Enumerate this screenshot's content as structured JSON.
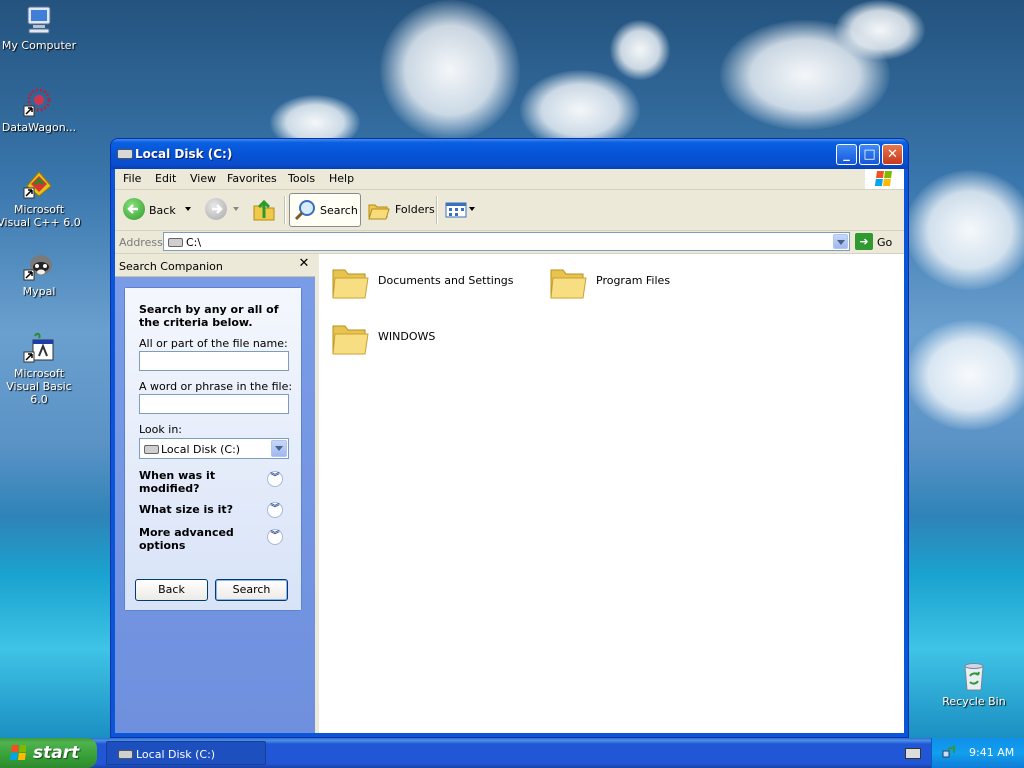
{
  "desktop": {
    "icons": [
      {
        "label": "My Computer"
      },
      {
        "label": "DataWagon..."
      },
      {
        "label": "Microsoft Visual C++ 6.0"
      },
      {
        "label": "Mypal"
      },
      {
        "label": "Microsoft Visual Basic 6.0"
      },
      {
        "label": "Recycle Bin"
      }
    ]
  },
  "window": {
    "title": "Local Disk (C:)",
    "menu": [
      "File",
      "Edit",
      "View",
      "Favorites",
      "Tools",
      "Help"
    ],
    "toolbar": {
      "back": "Back",
      "search": "Search",
      "folders": "Folders"
    },
    "address": {
      "label": "Address",
      "value": "C:\\",
      "go": "Go"
    },
    "search_companion": {
      "title": "Search Companion",
      "heading": "Search by any or all of the criteria below.",
      "filename_label": "All or part of the file name:",
      "filename_value": "",
      "phrase_label": "A word or phrase in the file:",
      "phrase_value": "",
      "lookin_label": "Look in:",
      "lookin_value": "Local Disk (C:)",
      "options": [
        "When was it modified?",
        "What size is it?",
        "More advanced options"
      ],
      "back_button": "Back",
      "search_button": "Search"
    },
    "folders": [
      {
        "name": "Documents and Settings"
      },
      {
        "name": "Program Files"
      },
      {
        "name": "WINDOWS"
      }
    ]
  },
  "taskbar": {
    "start": "start",
    "items": [
      {
        "label": "Local Disk (C:)"
      }
    ],
    "clock": "9:41 AM"
  }
}
